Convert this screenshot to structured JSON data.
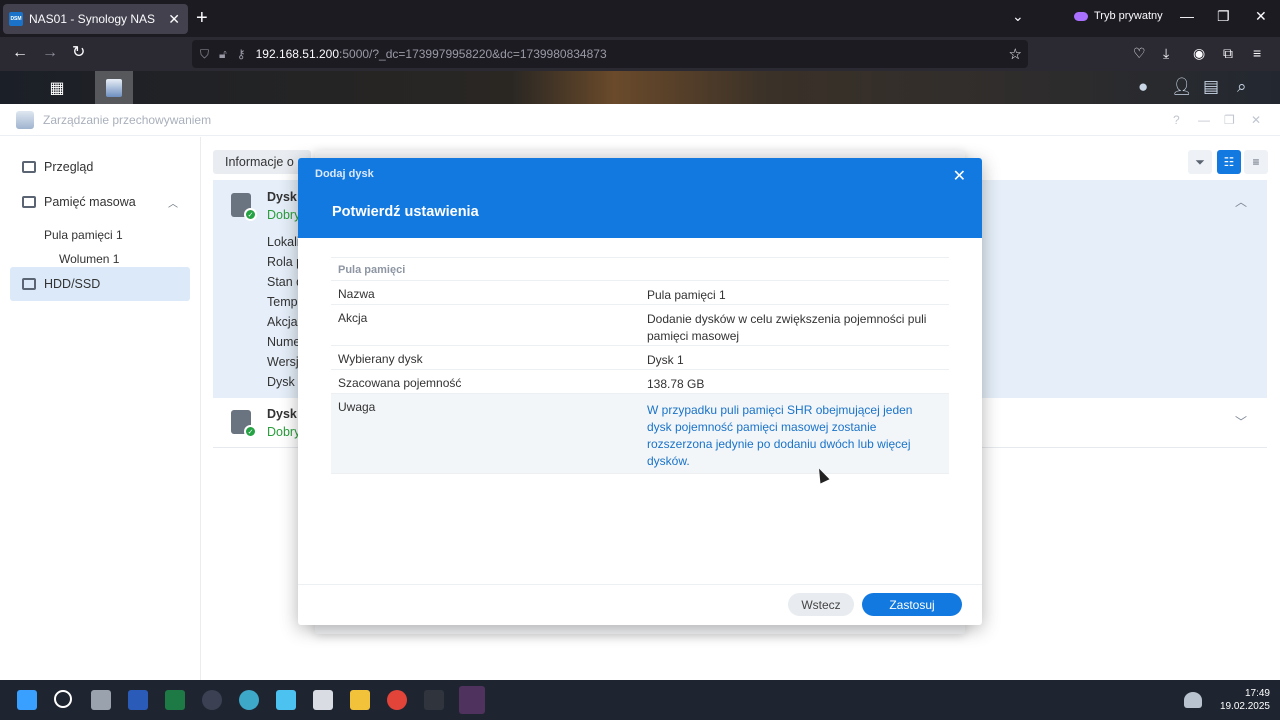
{
  "browser": {
    "tab_title": "NAS01 - Synology NAS",
    "favicon_text": "DSM",
    "private_label": "Tryb prywatny",
    "url_host": "192.168.51.200",
    "url_rest": ":5000/?_dc=1739979958220&dc=1739980834873"
  },
  "window": {
    "title": "Zarządzanie przechowywaniem"
  },
  "sidebar": {
    "items": [
      {
        "label": "Przegląd"
      },
      {
        "label": "Pamięć masowa"
      },
      {
        "label": "HDD/SSD"
      }
    ],
    "subitems": [
      {
        "label": "Pula pamięci 1"
      },
      {
        "label": "Wolumen 1"
      }
    ]
  },
  "content": {
    "info_tab": "Informacje o",
    "disk1": {
      "title": "Dysk",
      "status": "Dobry",
      "labels": [
        "Lokali",
        "Rola p",
        "Stan d",
        "Tempe",
        "Akcja",
        "Nume",
        "Wersj",
        "Dysk"
      ]
    },
    "disk2": {
      "title": "Dysk",
      "status": "Dobry"
    }
  },
  "modal": {
    "small_title": "Dodaj dysk",
    "title": "Potwierdź ustawienia",
    "section": "Pula pamięci",
    "rows": [
      {
        "key": "Nazwa",
        "value": "Pula pamięci 1"
      },
      {
        "key": "Akcja",
        "value": "Dodanie dysków w celu zwiększenia pojemności puli pamięci masowej"
      },
      {
        "key": "Wybierany dysk",
        "value": "Dysk 1"
      },
      {
        "key": "Szacowana pojemność",
        "value": "138.78 GB"
      },
      {
        "key": "Uwaga",
        "value": "W przypadku puli pamięci SHR obejmującej jeden dysk pojemność pamięci masowej zostanie rozszerzona jedynie po dodaniu dwóch lub więcej dysków."
      }
    ],
    "back_label": "Wstecz",
    "apply_label": "Zastosuj"
  },
  "taskbar": {
    "time": "17:49",
    "date": "19.02.2025"
  },
  "colors": {
    "accent": "#1279e0",
    "status_ok": "#2a9d3c",
    "note_text": "#1a73c8"
  }
}
